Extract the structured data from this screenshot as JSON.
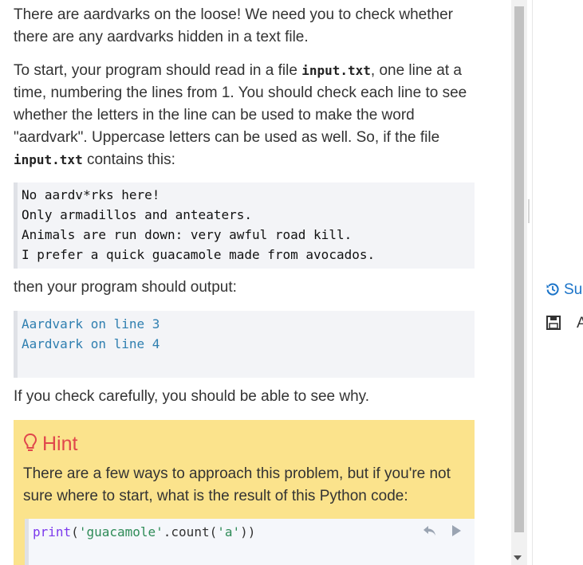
{
  "problem": {
    "intro": "There are aardvarks on the loose! We need you to check whether there are any aardvarks hidden in a text file.",
    "para2_part1": "To start, your program should read in a file ",
    "input_file": "input.txt",
    "para2_part2": ", one line at a time, numbering the lines from 1. You should check each line to see whether the letters in the line can be used to make the word \"aardvark\". Uppercase letters can be used as well. So, if the file ",
    "para2_part3": " contains this:",
    "input_lines": [
      "No aardv*rks here!",
      "Only armadillos and anteaters.",
      "Animals are run down: very awful road kill.",
      "I prefer a quick guacamole made from avocados."
    ],
    "then_text": "then your program should output:",
    "output_lines": [
      "Aardvark on line 3",
      "Aardvark on line 4"
    ],
    "check_text": "If you check carefully, you should be able to see why."
  },
  "hint": {
    "title": "Hint",
    "text": "There are a few ways to approach this problem, but if you're not sure where to start, what is the result of this Python code:",
    "code_fn": "print",
    "code_open": "(",
    "code_str1": "'guacamole'",
    "code_dot": ".count(",
    "code_str2": "'a'",
    "code_close": "))"
  },
  "sidebar": {
    "history_label": "Su",
    "save_label": "A"
  },
  "colors": {
    "hint_bg": "#fbe38c",
    "hint_title": "#e0474c",
    "output_text": "#2f7fb0",
    "link": "#1a73c8"
  }
}
